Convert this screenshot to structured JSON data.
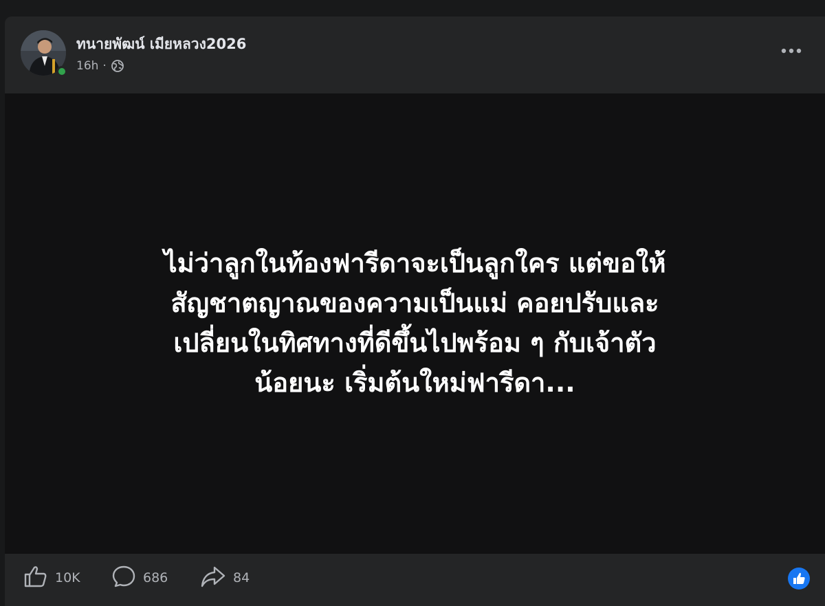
{
  "post": {
    "author": "ทนายพัฒน์ เมียหลวง2026",
    "time": "16h",
    "separator": "·",
    "text_lines": [
      "ไม่ว่าลูกในท้องฟารีดาจะเป็นลูกใคร แต่ขอให้",
      "สัญชาตญาณของความเป็นแม่ คอยปรับและ",
      "เปลี่ยนในทิศทางที่ดีขึ้นไปพร้อม ๆ กับเจ้าตัว",
      "น้อยนะ เริ่มต้นใหม่ฟารีดา..."
    ]
  },
  "actions": {
    "like_count": "10K",
    "comment_count": "686",
    "share_count": "84"
  },
  "icons": {
    "avatar": "profile-photo",
    "online": "online-status-dot",
    "privacy": "globe-icon",
    "more": "more-options-icon",
    "like": "thumbs-up-icon",
    "comment": "comment-bubble-icon",
    "share": "share-arrow-icon",
    "reaction": "like-reaction-badge"
  },
  "colors": {
    "background": "#18191a",
    "card": "#242526",
    "media": "#111112",
    "text_primary": "#e4e6eb",
    "text_secondary": "#b0b3b8",
    "accent": "#1877f2",
    "online": "#31a24c"
  }
}
